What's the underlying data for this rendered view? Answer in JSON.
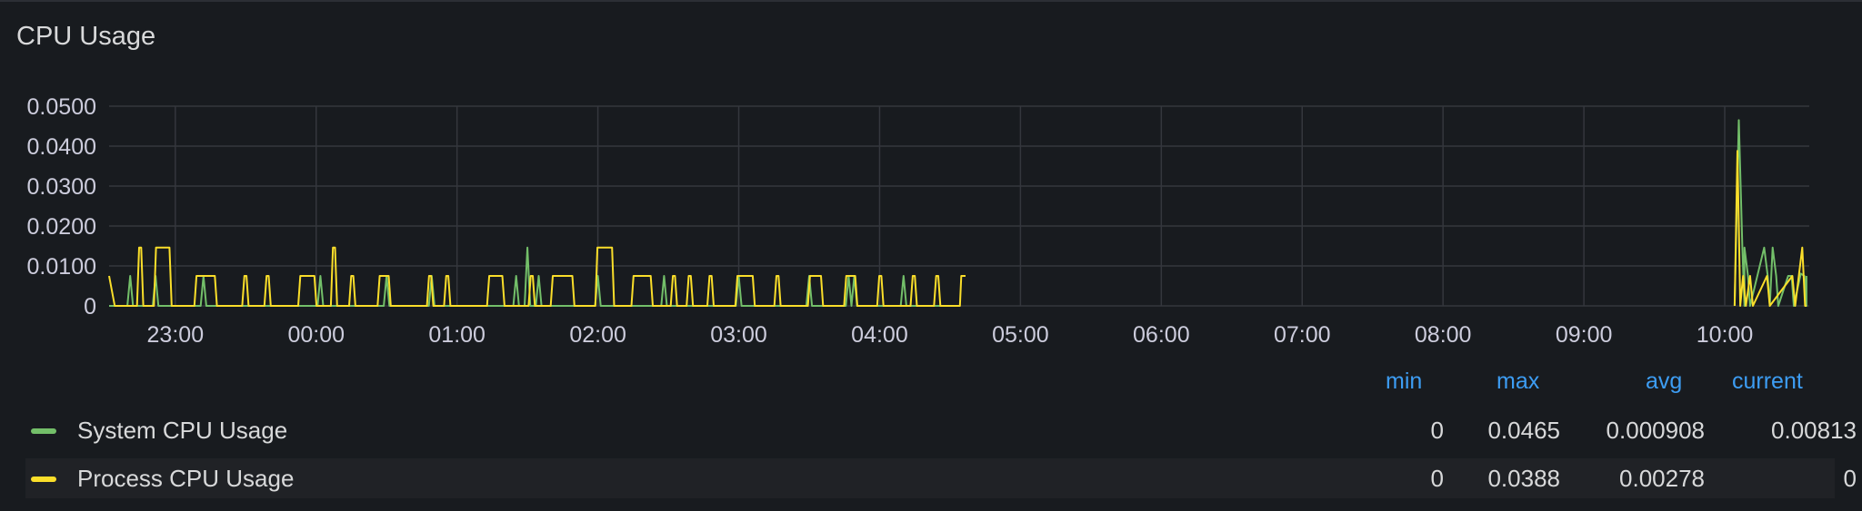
{
  "panel": {
    "title": "CPU Usage"
  },
  "chart_data": {
    "type": "line",
    "title": "CPU Usage",
    "ylim": [
      0,
      0.05
    ],
    "yticks": [
      "0.0500",
      "0.0400",
      "0.0300",
      "0.0200",
      "0.0100",
      "0"
    ],
    "xticks": [
      "23:00",
      "00:00",
      "01:00",
      "02:00",
      "03:00",
      "04:00",
      "05:00",
      "06:00",
      "07:00",
      "08:00",
      "09:00",
      "10:00"
    ],
    "x_range_hours": [
      22.53,
      10.6
    ],
    "grid": true,
    "series": [
      {
        "name": "System CPU Usage",
        "color": "#73bf69",
        "spikes": [
          [
            22.68,
            0.0075
          ],
          [
            22.86,
            0.0075
          ],
          [
            23.2,
            0.0075
          ],
          [
            0.03,
            0.0075
          ],
          [
            0.5,
            0.0075
          ],
          [
            0.82,
            0.0075
          ],
          [
            1.42,
            0.0075
          ],
          [
            1.5,
            0.0146
          ],
          [
            1.58,
            0.0075
          ],
          [
            2.0,
            0.0075
          ],
          [
            2.47,
            0.0075
          ],
          [
            3.0,
            0.0075
          ],
          [
            3.5,
            0.0075
          ],
          [
            3.78,
            0.0075
          ],
          [
            3.82,
            0.0075
          ],
          [
            4.17,
            0.0075
          ],
          [
            10.1,
            0.0465
          ],
          [
            10.14,
            0.0146
          ],
          [
            10.28,
            0.0146
          ],
          [
            10.34,
            0.0146
          ],
          [
            10.45,
            0.0075
          ],
          [
            10.54,
            0.0081
          ]
        ],
        "active_until_hour": 4.57,
        "resume_hour": 10.07
      },
      {
        "name": "Process CPU Usage",
        "color": "#fade2a",
        "spikes_high": [
          22.77,
          22.83,
          22.97,
          24.15,
          25.9,
          26.03
        ],
        "active_until_hour": 4.57,
        "resume_hour": 10.07,
        "tail": [
          [
            10.09,
            0.0388
          ],
          [
            10.13,
            0.0075
          ],
          [
            10.18,
            0.0075
          ],
          [
            10.3,
            0.0075
          ],
          [
            10.48,
            0.0075
          ],
          [
            10.55,
            0.0146
          ],
          [
            10.58,
            0
          ]
        ]
      }
    ]
  },
  "legend": {
    "headers": {
      "min": "min",
      "max": "max",
      "avg": "avg",
      "current": "current"
    },
    "rows": [
      {
        "name": "System CPU Usage",
        "color": "#73bf69",
        "min": "0",
        "max": "0.0465",
        "avg": "0.000908",
        "current": "0.00813"
      },
      {
        "name": "Process CPU Usage",
        "color": "#fade2a",
        "min": "0",
        "max": "0.0388",
        "avg": "0.00278",
        "current": "0"
      }
    ]
  }
}
